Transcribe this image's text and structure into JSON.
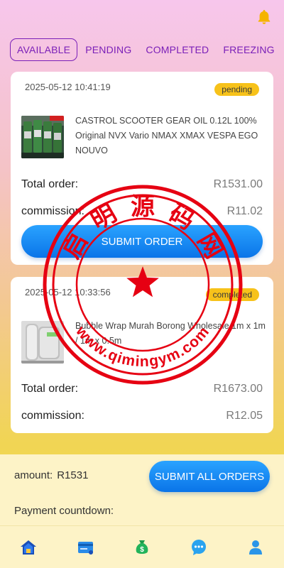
{
  "tabs": [
    "AVAILABLE",
    "PENDING",
    "COMPLETED",
    "FREEZING"
  ],
  "orders": [
    {
      "timestamp": "2025-05-12 10:41:19",
      "status": "pending",
      "product": "CASTROL SCOOTER GEAR OIL 0.12L 100% Original NVX Vario NMAX XMAX VESPA EGO NOUVO",
      "total_label": "Total order:",
      "total_value": "R1531.00",
      "commission_label": "commission:",
      "commission_value": "R11.02",
      "submit_label": "SUBMIT ORDER"
    },
    {
      "timestamp": "2025-05-12 10:33:56",
      "status": "completed",
      "product": "Bubble Wrap Murah Borong Wholesale 1m x 1m / 1m x 0.5m",
      "total_label": "Total order:",
      "total_value": "R1673.00",
      "commission_label": "commission:",
      "commission_value": "R12.05"
    }
  ],
  "footer": {
    "amount_label": "amount:",
    "amount_value": "R1531",
    "submit_all_label": "SUBMIT ALL ORDERS",
    "countdown_label": "Payment countdown:"
  },
  "nav": [
    "home-icon",
    "wallet-card-icon",
    "money-bag-icon",
    "chat-icon",
    "user-icon"
  ],
  "watermark": {
    "chars": [
      "启",
      "明",
      "源",
      "码",
      "网"
    ],
    "url": "www.qimingym.com"
  },
  "colors": {
    "accent_purple": "#7a1fb8",
    "button_blue": "#0a74e8",
    "badge_yellow": "#f7c21a",
    "watermark_red": "#e60012"
  }
}
